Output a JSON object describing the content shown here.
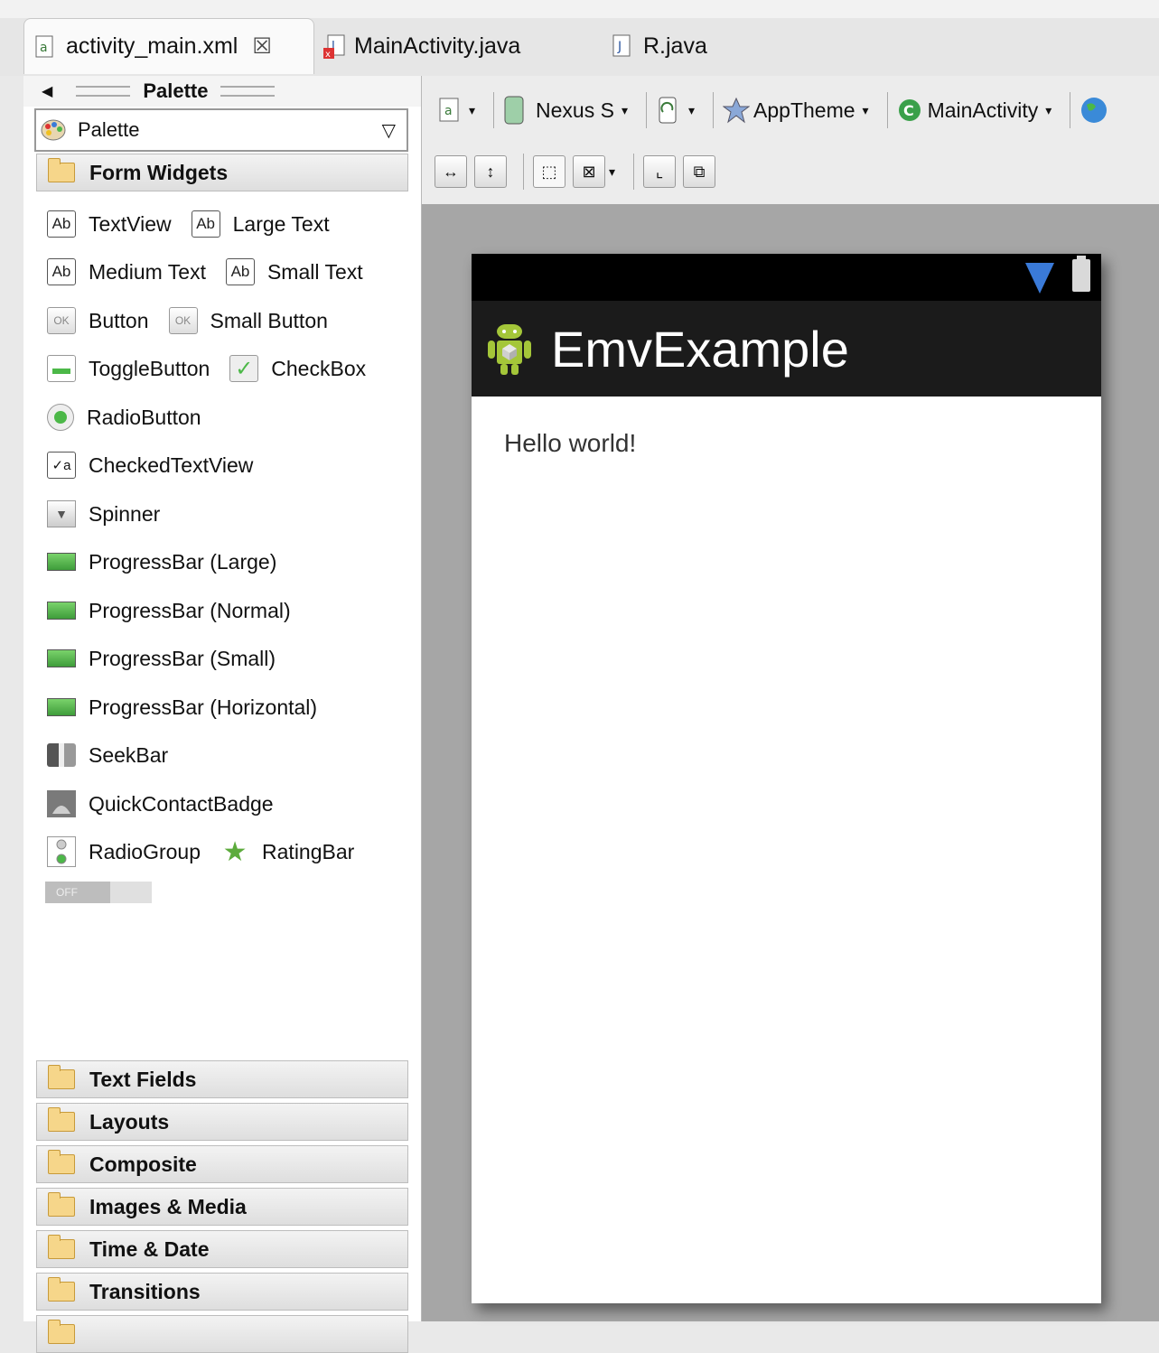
{
  "tabs": [
    {
      "label": "activity_main.xml",
      "close": "☒",
      "active": true
    },
    {
      "label": "MainActivity.java",
      "active": false
    },
    {
      "label": "R.java",
      "active": false
    }
  ],
  "palette": {
    "header": "Palette",
    "dropdown": "Palette",
    "categories": {
      "form_widgets": "Form Widgets",
      "text_fields": "Text Fields",
      "layouts": "Layouts",
      "composite": "Composite",
      "images_media": "Images & Media",
      "time_date": "Time & Date",
      "transitions": "Transitions"
    },
    "widgets": {
      "textview": "TextView",
      "large_text": "Large Text",
      "medium_text": "Medium Text",
      "small_text": "Small Text",
      "button": "Button",
      "small_button": "Small Button",
      "togglebutton": "ToggleButton",
      "checkbox": "CheckBox",
      "radiobutton": "RadioButton",
      "checkedtextview": "CheckedTextView",
      "spinner": "Spinner",
      "progress_large": "ProgressBar (Large)",
      "progress_normal": "ProgressBar (Normal)",
      "progress_small": "ProgressBar (Small)",
      "progress_horizontal": "ProgressBar (Horizontal)",
      "seekbar": "SeekBar",
      "quickcontactbadge": "QuickContactBadge",
      "radiogroup": "RadioGroup",
      "ratingbar": "RatingBar",
      "switch_off": "OFF"
    },
    "icon_text": {
      "ab": "Ab",
      "ok": "OK",
      "chk": "✓",
      "ctv": "✓a",
      "spin": "▼",
      "star": "★"
    }
  },
  "toolbar": {
    "device": "Nexus S",
    "theme": "AppTheme",
    "activity": "MainActivity",
    "dropdown_glyph": "▾"
  },
  "preview": {
    "app_title": "EmvExample",
    "hello_text": "Hello world!"
  },
  "colors": {
    "android_green": "#4cb848",
    "wifi_blue": "#3a7ad8",
    "action_bar": "#1b1b1b"
  }
}
